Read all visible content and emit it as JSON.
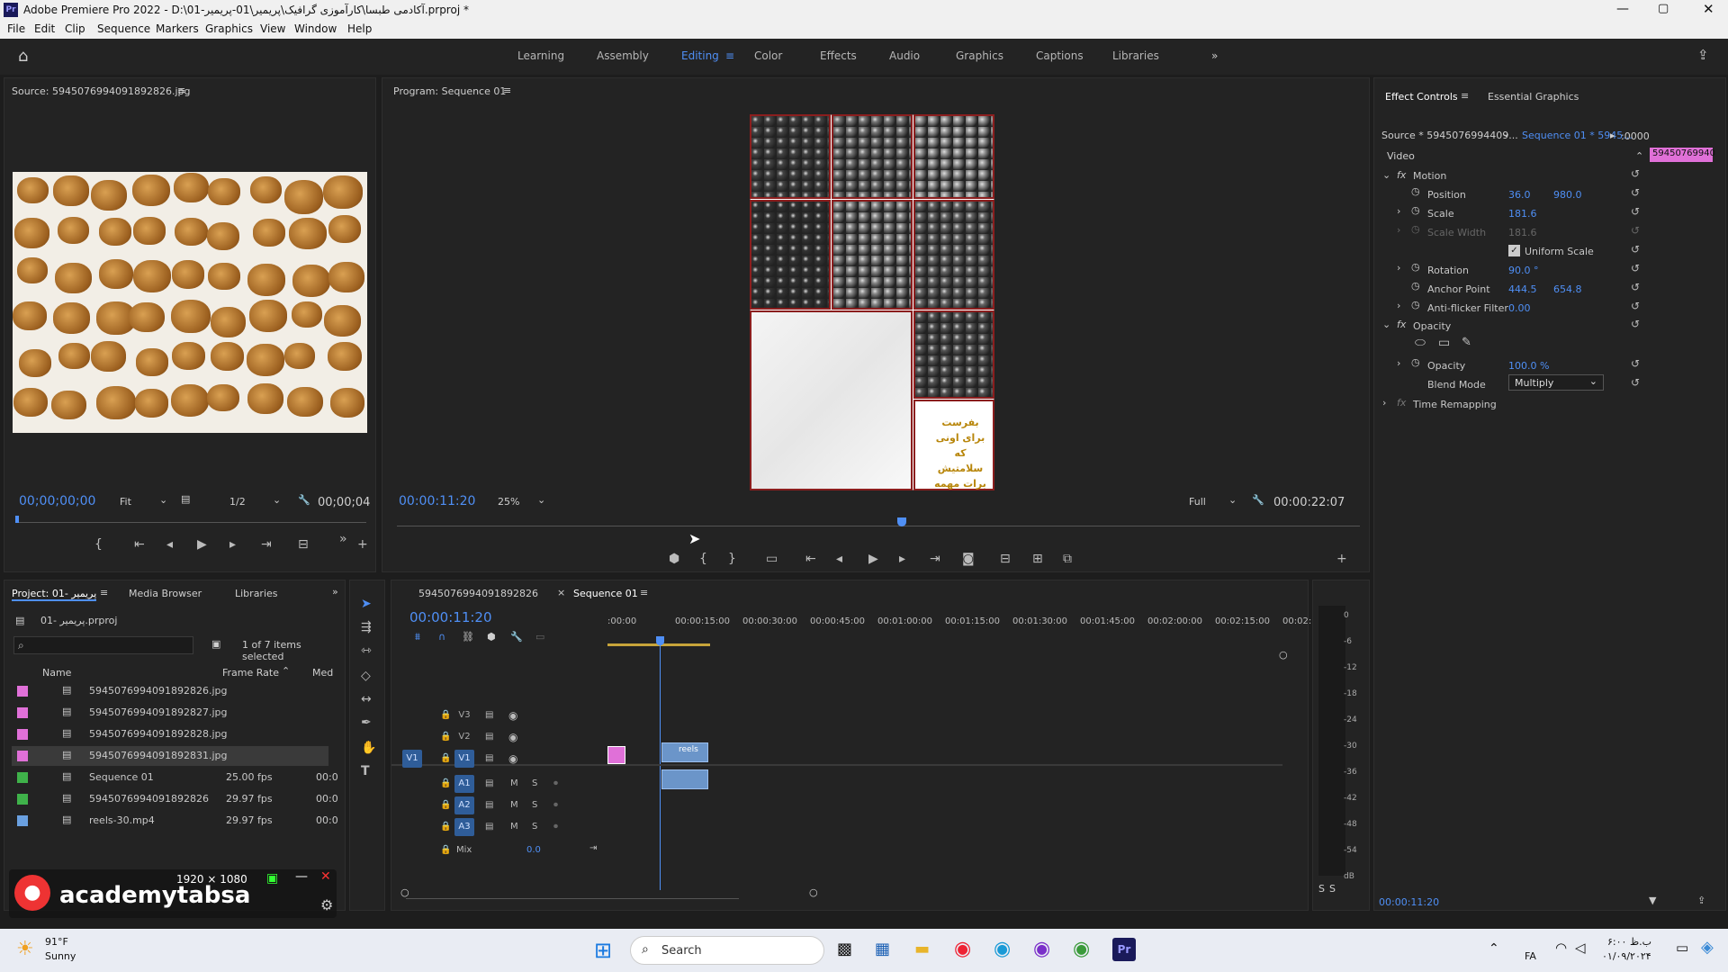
{
  "titlebar": {
    "title": "Adobe Premiere Pro 2022 - D:\\01-آکادمی طبسا\\کارآموزی گرافیک\\پریمیر\\01-پریمیر.prproj *"
  },
  "menu": [
    "File",
    "Edit",
    "Clip",
    "Sequence",
    "Markers",
    "Graphics",
    "View",
    "Window",
    "Help"
  ],
  "workspaces": [
    "Learning",
    "Assembly",
    "Editing",
    "Color",
    "Effects",
    "Audio",
    "Graphics",
    "Captions",
    "Libraries"
  ],
  "source": {
    "title": "Source: 5945076994091892826.jpg",
    "timecode": "00;00;00;00",
    "fit": "Fit",
    "res": "1/2",
    "duration": "00;00;04"
  },
  "program": {
    "title": "Program: Sequence 01",
    "timecode": "00:00:11:20",
    "zoom": "25%",
    "quality": "Full",
    "duration": "00:00:22:07",
    "poster_text": "بفرست برای اونی که سلامتیش برات مهمه"
  },
  "effect_controls": {
    "tabs": [
      "Effect Controls",
      "Essential Graphics"
    ],
    "source": "Source * 5945076994409...",
    "sequence": "Sequence 01 * 5945...",
    "time_label": ":0000",
    "clip_label": "59450769940",
    "video": "Video",
    "motion": "Motion",
    "position_label": "Position",
    "position_x": "36.0",
    "position_y": "980.0",
    "scale_label": "Scale",
    "scale": "181.6",
    "scale_width_label": "Scale Width",
    "scale_width": "181.6",
    "uniform_label": "Uniform Scale",
    "rotation_label": "Rotation",
    "rotation": "90.0 °",
    "anchor_label": "Anchor Point",
    "anchor_x": "444.5",
    "anchor_y": "654.8",
    "antiflicker_label": "Anti-flicker Filter",
    "antiflicker": "0.00",
    "opacity_group": "Opacity",
    "opacity_label": "Opacity",
    "opacity": "100.0 %",
    "blend_label": "Blend Mode",
    "blend": "Multiply",
    "time_remap": "Time Remapping",
    "bottom_tc": "00:00:11:20"
  },
  "project": {
    "tabs": [
      "Project: 01- پریمیر",
      "Media Browser",
      "Libraries"
    ],
    "file": "01- پریمیر.prproj",
    "count": "1 of 7 items selected",
    "col_name": "Name",
    "col_rate": "Frame Rate",
    "col_med": "Med",
    "items": [
      {
        "name": "5945076994091892826.jpg",
        "rate": "",
        "med": "",
        "color": "#e070d8"
      },
      {
        "name": "5945076994091892827.jpg",
        "rate": "",
        "med": "",
        "color": "#e070d8"
      },
      {
        "name": "5945076994091892828.jpg",
        "rate": "",
        "med": "",
        "color": "#e070d8"
      },
      {
        "name": "5945076994091892831.jpg",
        "rate": "",
        "med": "",
        "color": "#e070d8"
      },
      {
        "name": "Sequence 01",
        "rate": "25.00 fps",
        "med": "00:0",
        "color": "#3fb24a"
      },
      {
        "name": "5945076994091892826",
        "rate": "29.97 fps",
        "med": "00:0",
        "color": "#3fb24a"
      },
      {
        "name": "reels-30.mp4",
        "rate": "29.97 fps",
        "med": "00:0",
        "color": "#6aa0e0"
      }
    ]
  },
  "timeline": {
    "tabs": [
      "5945076994091892826",
      "Sequence 01"
    ],
    "timecode": "00:00:11:20",
    "ruler": [
      ":00:00",
      "00:00:15:00",
      "00:00:30:00",
      "00:00:45:00",
      "00:01:00:00",
      "00:01:15:00",
      "00:01:30:00",
      "00:01:45:00",
      "00:02:00:00",
      "00:02:15:00",
      "00:02:"
    ],
    "tracks_v": [
      "V3",
      "V2",
      "V1"
    ],
    "tracks_a": [
      "A1",
      "A2",
      "A3"
    ],
    "mix_label": "Mix",
    "mix_value": "0.0",
    "clip_label": "reels",
    "meter": [
      "0",
      "-6",
      "-12",
      "-18",
      "-24",
      "-30",
      "-36",
      "-42",
      "-48",
      "-54",
      "dB"
    ]
  },
  "overlay": {
    "size": "1920 × 1080",
    "watermark": "academytabsa"
  },
  "taskbar": {
    "weather_temp": "91°F",
    "weather_desc": "Sunny",
    "search": "Search",
    "lang": "FA",
    "time": "۶:۰۰ ب.ظ",
    "date": "۰۱/۰۹/۲۰۲۴"
  }
}
